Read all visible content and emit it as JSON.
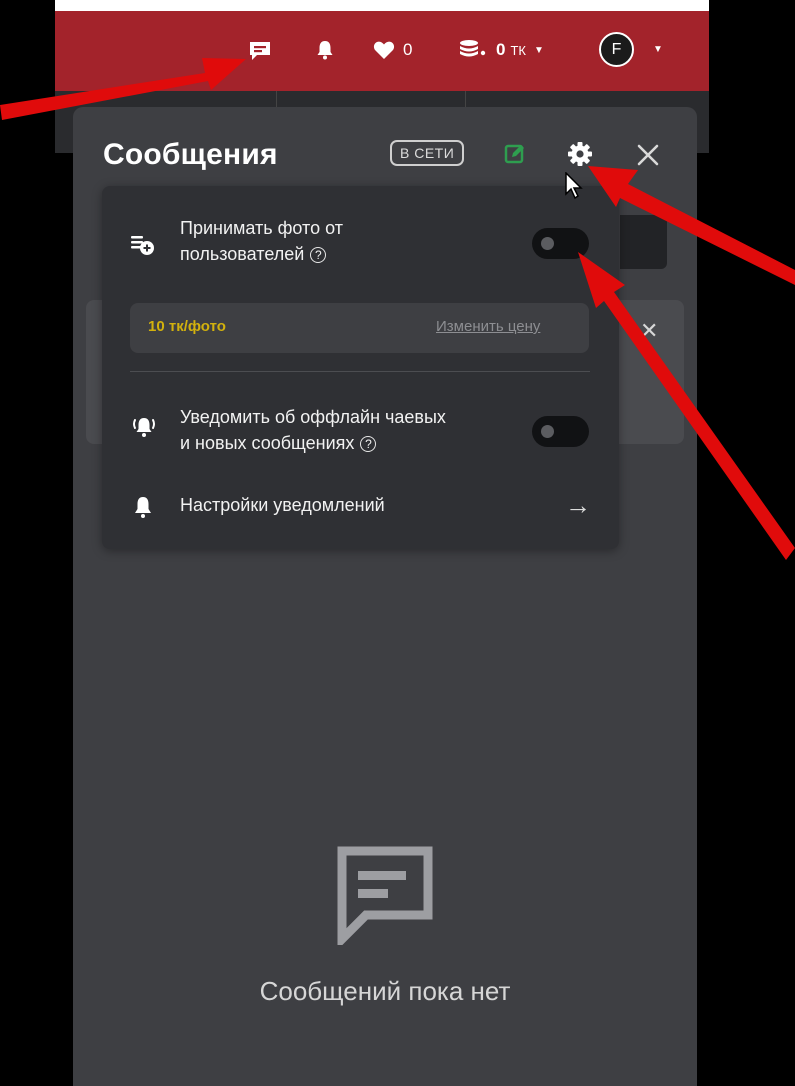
{
  "header": {
    "likes_count": "0",
    "balance_amount": "0",
    "balance_unit": "ТК",
    "avatar_letter": "F",
    "accent_color": "#a3232b"
  },
  "messages_panel": {
    "title": "Сообщения",
    "status_badge": "В СЕТИ",
    "empty_text": "Сообщений пока нет",
    "compose_color": "#2e9e4f"
  },
  "settings": {
    "accept_photos_line1": "Принимать фото от",
    "accept_photos_line2": "пользователей",
    "accept_photos_enabled": false,
    "price_label": "10 тк/фото",
    "price_color": "#d2b10d",
    "change_price": "Изменить цену",
    "notify_line1": "Уведомить об оффлайн чаевых",
    "notify_line2": "и новых сообщениях",
    "notify_enabled": false,
    "notification_settings": "Настройки уведомлений",
    "help_glyph": "?"
  },
  "icons": {
    "messages": "chat-icon",
    "notifications": "bell-icon",
    "likes": "heart-icon",
    "balance": "coins-icon",
    "settings": "gear-icon",
    "close": "close-icon",
    "compose": "compose-icon",
    "arrow": "arrow-right-icon"
  },
  "annotation_color": "#e00b0b"
}
